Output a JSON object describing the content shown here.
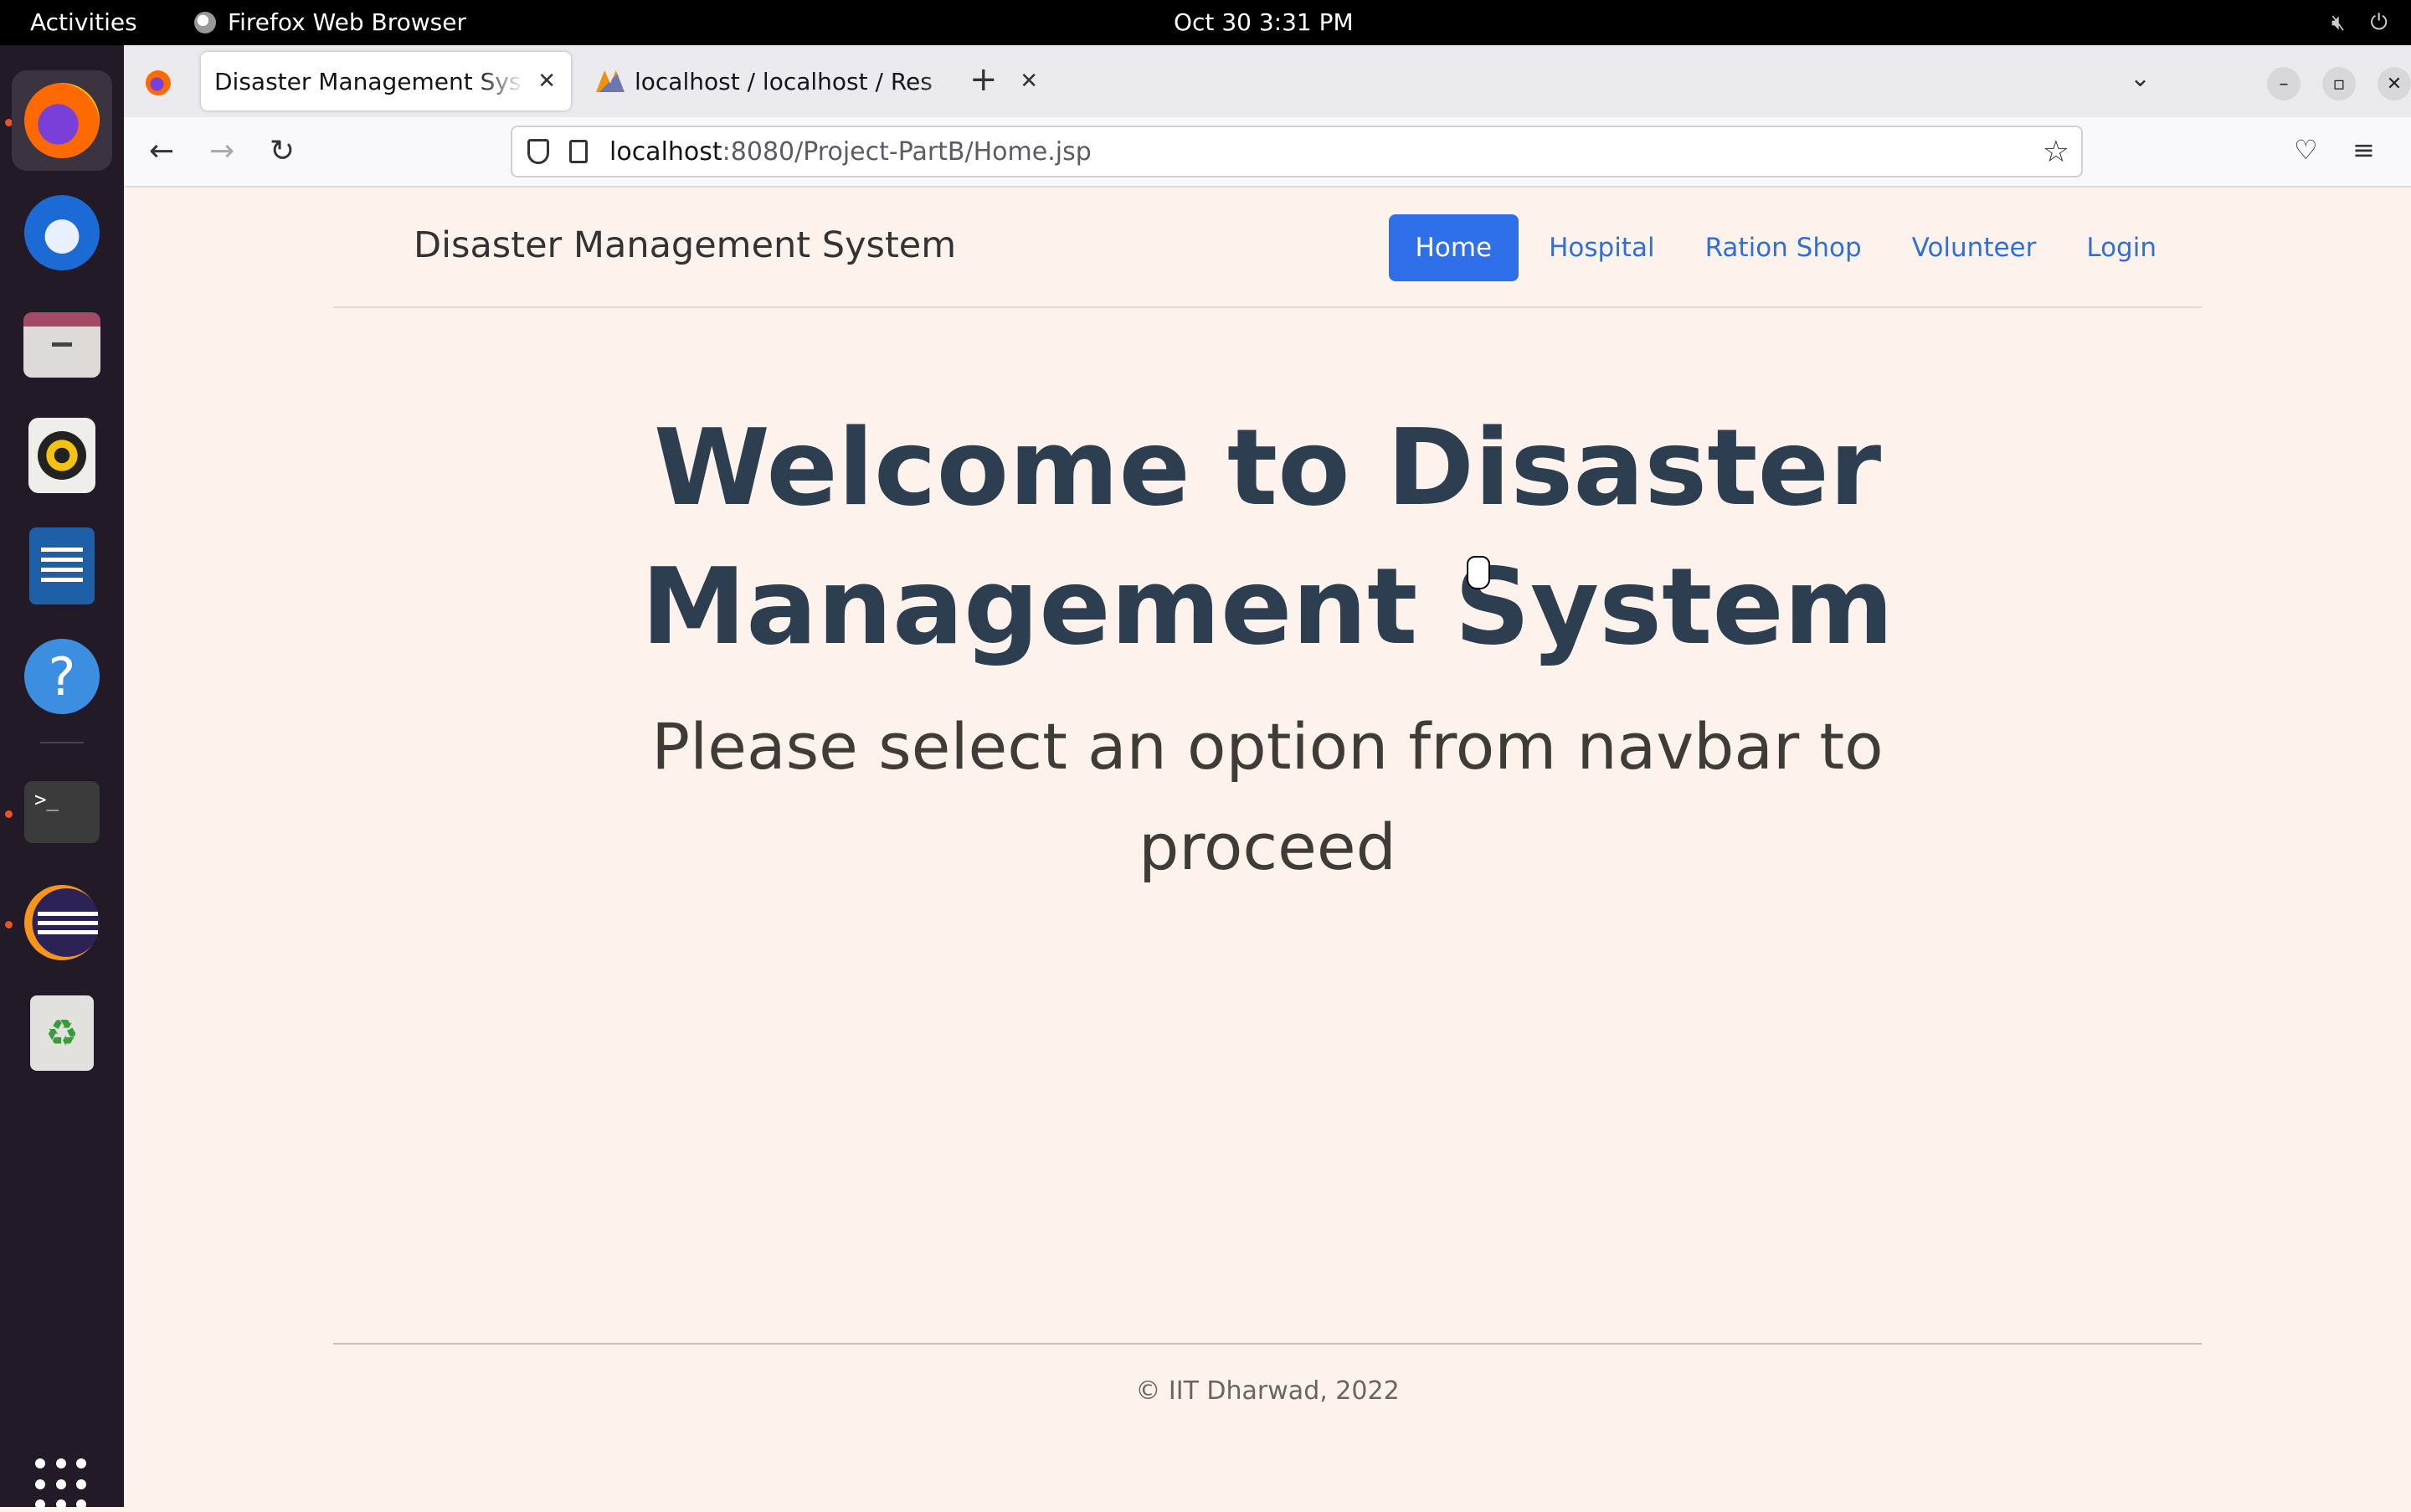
{
  "system": {
    "activities": "Activities",
    "app_name": "Firefox Web Browser",
    "clock": "Oct 30  3:31 PM"
  },
  "dock": {
    "items": [
      "firefox-icon",
      "thunderbird-icon",
      "files-icon",
      "rhythmbox-icon",
      "writer-icon",
      "help-icon",
      "terminal-icon",
      "eclipse-icon",
      "trash-icon"
    ]
  },
  "browser": {
    "tabs": [
      {
        "label": "Disaster Management System",
        "active": true
      },
      {
        "label": "localhost / localhost / Res",
        "active": false
      }
    ],
    "url_host": "localhost",
    "url_rest": ":8080/Project-PartB/Home.jsp"
  },
  "site": {
    "brand": "Disaster Management System",
    "nav": [
      {
        "label": "Home",
        "active": true
      },
      {
        "label": "Hospital",
        "active": false
      },
      {
        "label": "Ration Shop",
        "active": false
      },
      {
        "label": "Volunteer",
        "active": false
      },
      {
        "label": "Login",
        "active": false
      }
    ],
    "hero_title": "Welcome to Disaster Management System",
    "hero_subtitle": "Please select an option from navbar to proceed",
    "footer": "© IIT Dharwad, 2022",
    "accent_color": "#2f6fe9"
  }
}
